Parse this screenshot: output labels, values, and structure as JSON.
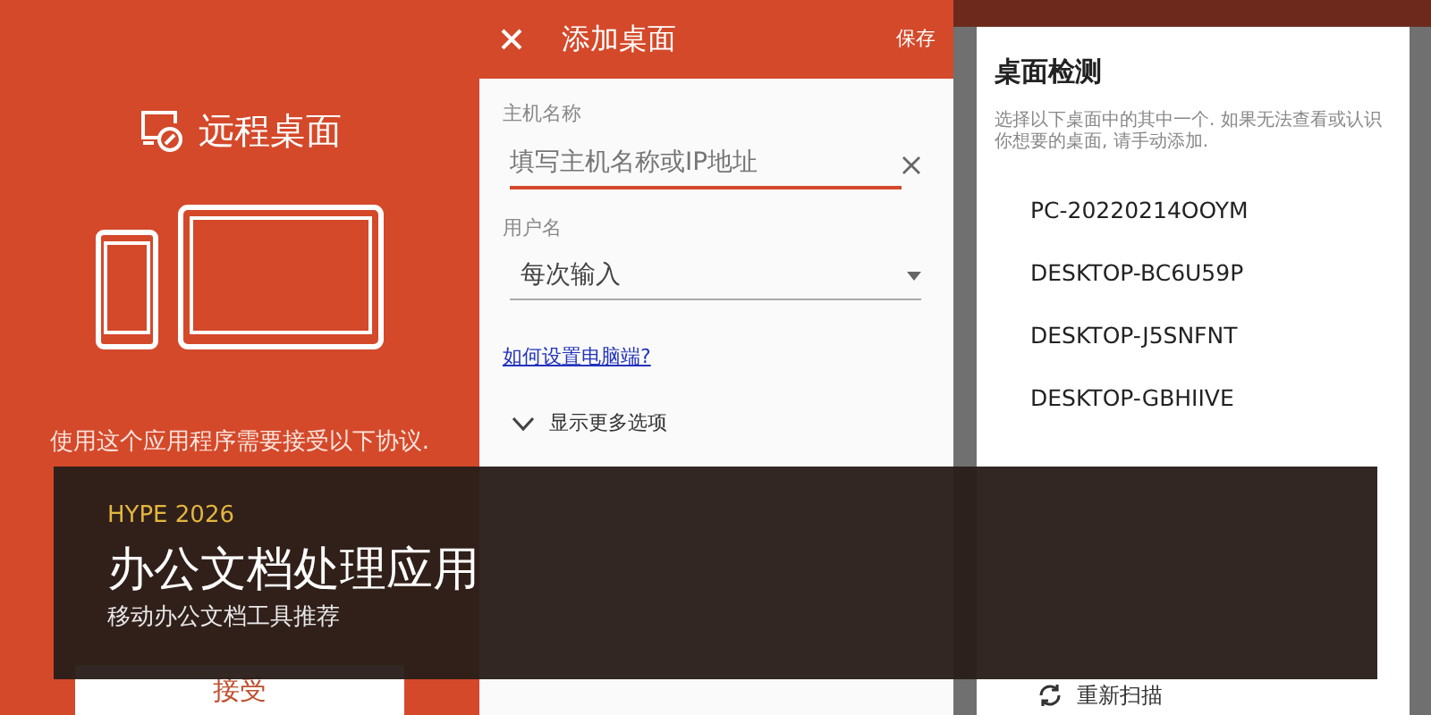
{
  "left_panel": {
    "app_title": "远程桌面",
    "agreement_text": "使用这个应用程序需要接受以下协议.",
    "accept_button": "接受"
  },
  "add_desktop": {
    "title": "添加桌面",
    "save": "保存",
    "fields": [
      {
        "kind": "text",
        "label": "主机名称",
        "placeholder": "填写主机名称或IP地址",
        "focused": true
      },
      {
        "kind": "select",
        "label": "用户名",
        "value": "每次输入",
        "focused": false
      }
    ],
    "help_link": "如何设置电脑端?",
    "more_options": "显示更多选项",
    "expanded": false
  },
  "detect_dialog": {
    "title": "桌面检测",
    "description": "选择以下桌面中的其中一个. 如果无法查看或认识你想要的桌面, 请手动添加.",
    "items": [
      "PC-20220214OOYM",
      "DESKTOP-BC6U59P",
      "DESKTOP-J5SNFNT",
      "DESKTOP-GBHIIVE"
    ],
    "rescan": "重新扫描"
  },
  "caption": {
    "tag": "HYPE 2026",
    "title": "办公文档处理应用",
    "subtitle": "移动办公文档工具推荐"
  }
}
